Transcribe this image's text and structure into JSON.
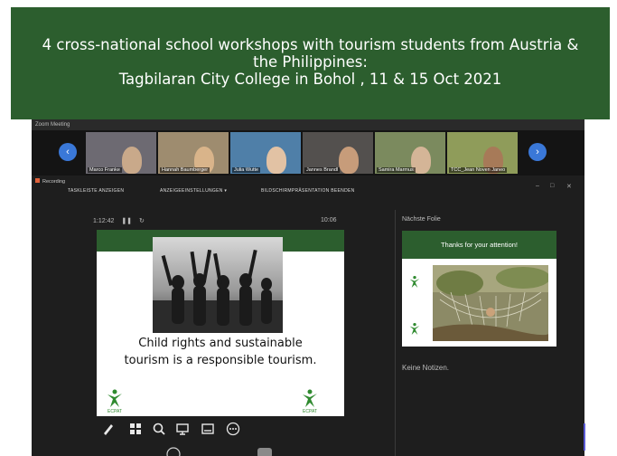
{
  "banner": {
    "line1": "4 cross-national school workshops with tourism students from Austria &",
    "line2": "the Philippines:",
    "line3": "Tagbilaran City College in Bohol , 11 & 15 Oct 2021"
  },
  "meeting": {
    "window_label": "Zoom Meeting",
    "participants": [
      {
        "name": "Marco Franke",
        "bg": "#6d6a72",
        "head": "#c9a98a"
      },
      {
        "name": "Hannah Baumberger",
        "bg": "#9e8c6f",
        "head": "#d9b48a"
      },
      {
        "name": "Julia Wutte",
        "bg": "#4f7fa8",
        "head": "#e2c2a4"
      },
      {
        "name": "Jannes Brandl",
        "bg": "#53504e",
        "head": "#c79c7a"
      },
      {
        "name": "Samira Marmus",
        "bg": "#7b8a5e",
        "head": "#d4b597"
      },
      {
        "name": "TCC_Jean Noven Janeo",
        "bg": "#8f9c5a",
        "head": "#a77a58"
      }
    ],
    "nav_prev": "‹",
    "nav_next": "›",
    "recording_label": "Recording",
    "toolbar": {
      "taskbar": "TASKLEISTE ANZEIGEN",
      "display_settings": "ANZEIGEEINSTELLUNGEN ▾",
      "end_show": "BILDSCHIRMPRÄSENTATION BEENDEN"
    },
    "window_controls": {
      "minimize": "–",
      "maximize": "□",
      "close": "✕"
    },
    "elapsed": "1:12:42",
    "pause_icon": "❚❚",
    "reset_icon": "↻",
    "clock": "10:06"
  },
  "slide": {
    "text_line1": "Child rights and sustainable",
    "text_line2": "tourism is a responsible tourism.",
    "logo_left": "ECPAT",
    "logo_right": "ECPAT"
  },
  "next": {
    "label": "Nächste Folie",
    "heading": "Thanks for your attention!",
    "notes": "Keine Notizen."
  },
  "icons": [
    "pen-icon",
    "slides-icon",
    "zoom-icon",
    "pointer-icon",
    "subtitles-icon",
    "more-icon"
  ],
  "colors": {
    "brand_green": "#2c5e2e",
    "dark_bg": "#1e1e1e",
    "accent_blue": "#3a78d8"
  }
}
